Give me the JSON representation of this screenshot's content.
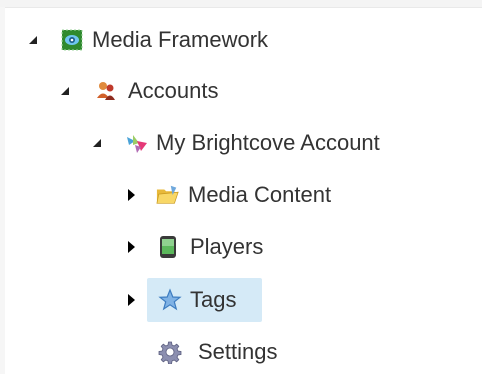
{
  "tree": {
    "items": [
      {
        "label": "Media Framework",
        "icon": "media-framework-icon",
        "state": "expanded"
      },
      {
        "label": "Accounts",
        "icon": "accounts-icon",
        "state": "expanded"
      },
      {
        "label": "My Brightcove Account",
        "icon": "brightcove-account-icon",
        "state": "expanded"
      },
      {
        "label": "Media Content",
        "icon": "folder-icon",
        "state": "collapsed"
      },
      {
        "label": "Players",
        "icon": "player-icon",
        "state": "collapsed"
      },
      {
        "label": "Tags",
        "icon": "star-icon",
        "state": "collapsed",
        "selected": true
      },
      {
        "label": "Settings",
        "icon": "gear-icon",
        "state": "leaf"
      }
    ]
  },
  "colors": {
    "text": "#333333",
    "selection": "#d5eaf7",
    "expanded_toggle": "#222222",
    "collapsed_toggle": "#000000"
  }
}
